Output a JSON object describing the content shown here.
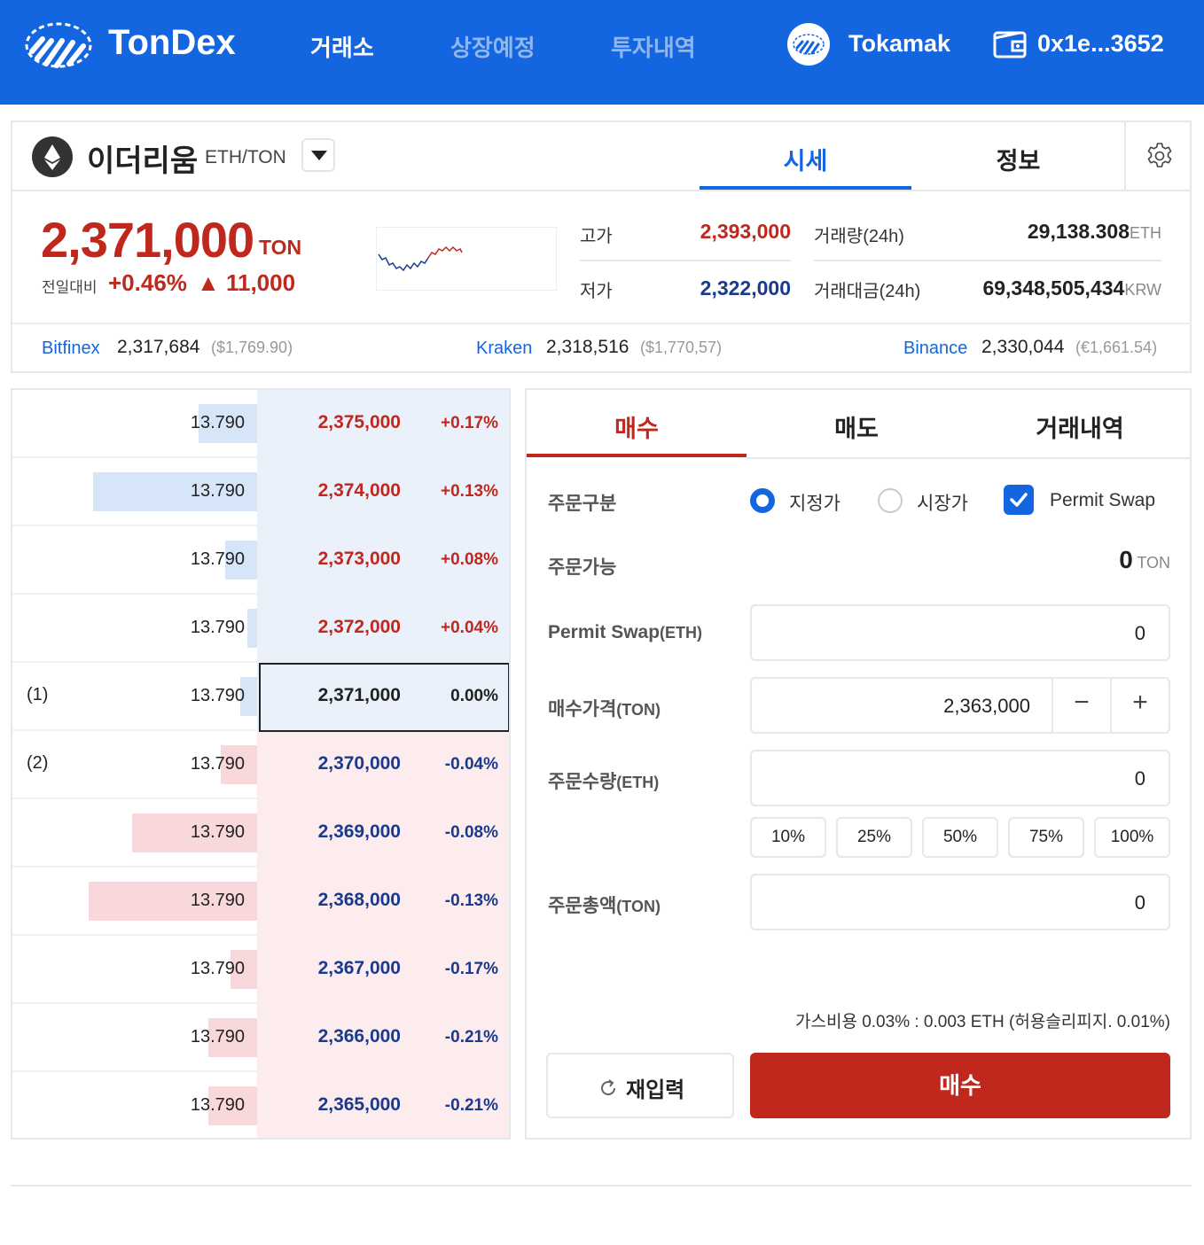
{
  "header": {
    "brand": "TonDex",
    "nav": [
      "거래소",
      "상장예정",
      "투자내역"
    ],
    "active_nav": "거래소",
    "network": "Tokamak",
    "wallet_address": "0x1e...3652",
    "colors": {
      "header_bg": "#1466e0"
    }
  },
  "market": {
    "coin_name": "이더리움",
    "pair": "ETH/TON",
    "tabs": [
      "시세",
      "정보"
    ],
    "active_tab": "시세",
    "price": "2,371,000",
    "price_unit": "TON",
    "prev_label": "전일대비",
    "change_pct": "+0.46%",
    "change_abs": "▲ 11,000",
    "stats": {
      "high_label": "고가",
      "high": "2,393,000",
      "low_label": "저가",
      "low": "2,322,000",
      "volume_label": "거래량(24h)",
      "volume": "29,138.308",
      "volume_unit": "ETH",
      "amount_label": "거래대금(24h)",
      "amount": "69,348,505,434",
      "amount_unit": "KRW"
    },
    "exchanges": [
      {
        "name": "Bitfinex",
        "price": "2,317,684",
        "alt": "($1,769.90)"
      },
      {
        "name": "Kraken",
        "price": "2,318,516",
        "alt": "($1,770,57)"
      },
      {
        "name": "Binance",
        "price": "2,330,044",
        "alt": "(€1,661.54)"
      }
    ],
    "colors": {
      "up": "#c0281e",
      "down": "#1a3a8f",
      "accent": "#1466e0"
    }
  },
  "orderbook": {
    "rows": [
      {
        "marker": "",
        "qty": "13.790",
        "price": "2,375,000",
        "pct": "+0.17%",
        "side": "ask",
        "depth": 0.24
      },
      {
        "marker": "",
        "qty": "13.790",
        "price": "2,374,000",
        "pct": "+0.13%",
        "side": "ask",
        "depth": 0.67
      },
      {
        "marker": "",
        "qty": "13.790",
        "price": "2,373,000",
        "pct": "+0.08%",
        "side": "ask",
        "depth": 0.13
      },
      {
        "marker": "",
        "qty": "13.790",
        "price": "2,372,000",
        "pct": "+0.04%",
        "side": "ask",
        "depth": 0.04
      },
      {
        "marker": "(1)",
        "qty": "13.790",
        "price": "2,371,000",
        "pct": "0.00%",
        "side": "current",
        "depth": 0.07
      },
      {
        "marker": "(2)",
        "qty": "13.790",
        "price": "2,370,000",
        "pct": "-0.04%",
        "side": "bid",
        "depth": 0.15
      },
      {
        "marker": "",
        "qty": "13.790",
        "price": "2,369,000",
        "pct": "-0.08%",
        "side": "bid",
        "depth": 0.51
      },
      {
        "marker": "",
        "qty": "13.790",
        "price": "2,368,000",
        "pct": "-0.13%",
        "side": "bid",
        "depth": 0.69
      },
      {
        "marker": "",
        "qty": "13.790",
        "price": "2,367,000",
        "pct": "-0.17%",
        "side": "bid",
        "depth": 0.11
      },
      {
        "marker": "",
        "qty": "13.790",
        "price": "2,366,000",
        "pct": "-0.21%",
        "side": "bid",
        "depth": 0.2
      },
      {
        "marker": "",
        "qty": "13.790",
        "price": "2,365,000",
        "pct": "-0.21%",
        "side": "bid",
        "depth": 0.2
      }
    ],
    "colors": {
      "ask_bg": "#eaf1fb",
      "ask_bar": "#d6e5f8",
      "bid_bg": "#fceced",
      "bid_bar": "#f8d8da"
    }
  },
  "order": {
    "tabs": [
      "매수",
      "매도",
      "거래내역"
    ],
    "active_tab": "매수",
    "type_label": "주문구분",
    "type_options": [
      "지정가",
      "시장가"
    ],
    "selected_type": "지정가",
    "permit_swap_label": "Permit Swap",
    "permit_swap_checked": true,
    "available_label": "주문가능",
    "available_value": "0",
    "available_unit": "TON",
    "permit_field_label": "Permit Swap",
    "permit_field_unit": "(ETH)",
    "permit_field_value": "0",
    "price_label": "매수가격",
    "price_unit": "(TON)",
    "price_value": "2,363,000",
    "minus": "−",
    "plus": "+",
    "qty_label": "주문수량",
    "qty_unit": "(ETH)",
    "qty_value": "0",
    "percent_buttons": [
      "10%",
      "25%",
      "50%",
      "75%",
      "100%"
    ],
    "total_label": "주문총액",
    "total_unit": "(TON)",
    "total_value": "0",
    "gas_note": "가스비용 0.03% : 0.003 ETH  (허용슬리피지. 0.01%)",
    "reset_label": "재입력",
    "submit_label": "매수",
    "colors": {
      "buy": "#c0281e"
    }
  }
}
